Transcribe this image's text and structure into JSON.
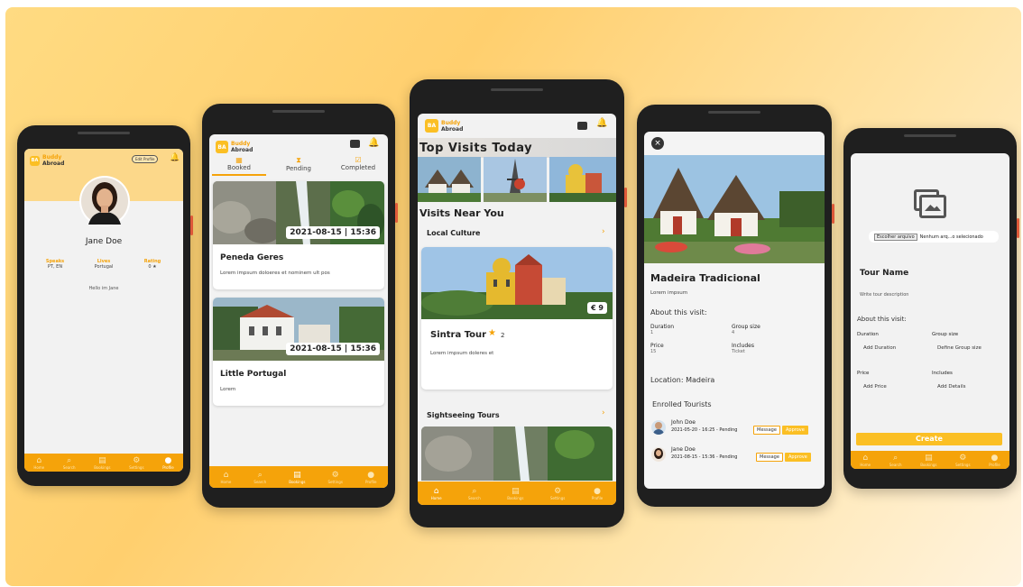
{
  "colors": {
    "accent": "#f5a30a",
    "accent_light": "#fbbf24",
    "profile_header": "#fcd88a"
  },
  "brand": {
    "line1": "Buddy",
    "line2": "Abroad",
    "mark": "BA"
  },
  "nav": [
    {
      "label": "Home",
      "icon": "home-icon",
      "glyph": "⌂"
    },
    {
      "label": "Search",
      "icon": "search-icon",
      "glyph": "⌕"
    },
    {
      "label": "Bookings",
      "icon": "calendar-icon",
      "glyph": "▤"
    },
    {
      "label": "Settings",
      "icon": "gear-icon",
      "glyph": "⚙"
    },
    {
      "label": "Profile",
      "icon": "person-icon",
      "glyph": "●"
    }
  ],
  "profile": {
    "edit_label": "Edit Profile",
    "name": "Jane Doe",
    "stats": [
      {
        "label": "Speaks",
        "value": "PT, EN"
      },
      {
        "label": "Lives",
        "value": "Portugal"
      },
      {
        "label": "Rating",
        "value": "0 ★"
      }
    ],
    "bio": "Hello im Jane"
  },
  "bookings": {
    "tabs": [
      {
        "label": "Booked"
      },
      {
        "label": "Pending"
      },
      {
        "label": "Completed"
      }
    ],
    "items": [
      {
        "date": "2021-08-15 | 15:36",
        "title": "Peneda Geres",
        "desc": "Lorem impsum doloeres et nominem ult pos"
      },
      {
        "date": "2021-08-15 | 15:36",
        "title": "Little Portugal",
        "desc": "Lorem"
      }
    ]
  },
  "home": {
    "top_title": "Top Visits Today",
    "near_title": "Visits Near You",
    "local_culture": "Local Culture",
    "featured": {
      "price": "€ 9",
      "title": "Sintra Tour",
      "rating": "2",
      "desc": "Lorem impsum doleres et"
    },
    "sightseeing": "Sightseeing Tours"
  },
  "detail": {
    "title": "Madeira Tradicional",
    "subtitle": "Lorem impsum",
    "about": "About this visit:",
    "fields": [
      {
        "label": "Duration",
        "value": "1"
      },
      {
        "label": "Group size",
        "value": "4"
      },
      {
        "label": "Price",
        "value": "15"
      },
      {
        "label": "Includes",
        "value": "Ticket"
      }
    ],
    "location": "Location: Madeira",
    "enrolled_title": "Enrolled Tourists",
    "tourists": [
      {
        "name": "John Doe",
        "info": "2021-05-20 - 16:25 - Pending",
        "message": "Message",
        "approve": "Approve"
      },
      {
        "name": "Jane Doe",
        "info": "2021-08-15 - 15:36 - Pending",
        "message": "Message",
        "approve": "Approve"
      }
    ]
  },
  "create": {
    "file_button": "Escolher arquivo",
    "file_status": "Nenhum arq...o selecionado",
    "name_placeholder": "Tour Name",
    "desc_placeholder": "Write tour description",
    "about": "About this visit:",
    "fields": [
      {
        "label": "Duration",
        "placeholder": "Add Duration"
      },
      {
        "label": "Group size",
        "placeholder": "Define Group size"
      },
      {
        "label": "Price",
        "placeholder": "Add Price"
      },
      {
        "label": "Includes",
        "placeholder": "Add Details"
      }
    ],
    "create_label": "Create"
  }
}
